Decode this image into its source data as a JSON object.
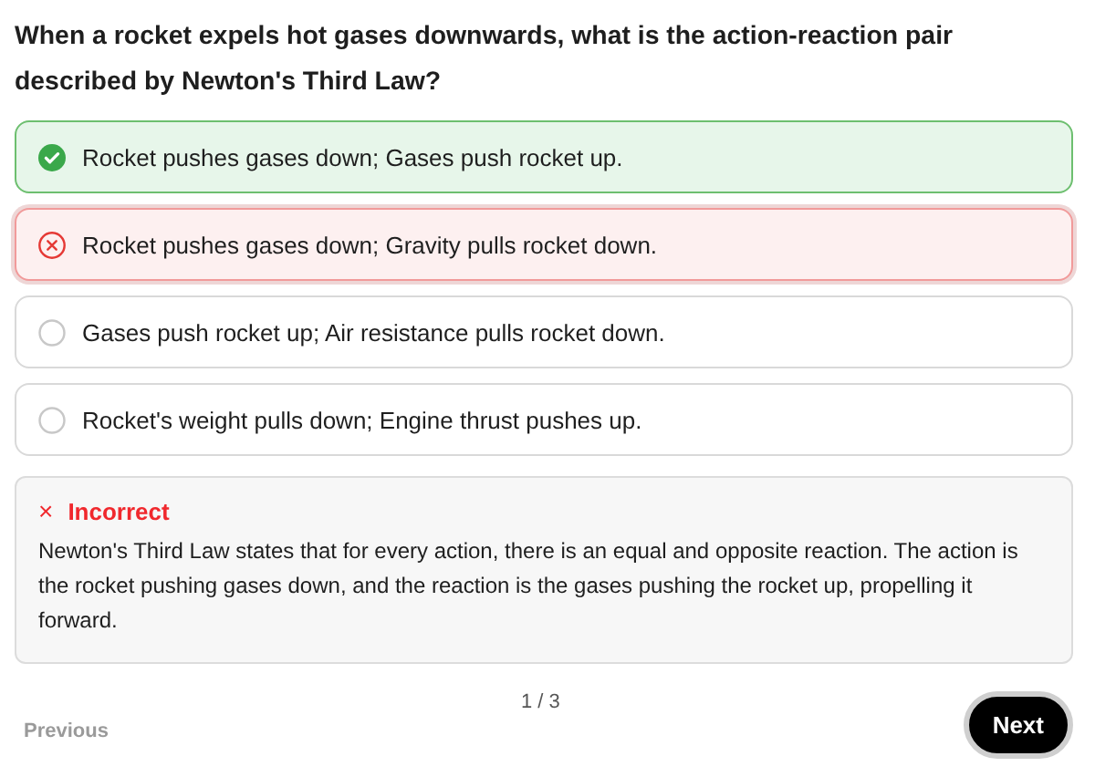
{
  "question": "When a rocket expels hot gases downwards, what is the action-reaction pair described by Newton's Third Law?",
  "options": [
    {
      "label": "Rocket pushes gases down; Gases push rocket up.",
      "kind": "correct",
      "selected": false
    },
    {
      "label": "Rocket pushes gases down; Gravity pulls rocket down.",
      "kind": "wrong",
      "selected": true
    },
    {
      "label": "Gases push rocket up; Air resistance pulls rocket down.",
      "kind": "neutral",
      "selected": false
    },
    {
      "label": "Rocket's weight pulls down; Engine thrust pushes up.",
      "kind": "neutral",
      "selected": false
    }
  ],
  "feedback": {
    "mark": "×",
    "title": "Incorrect",
    "text": "Newton's Third Law states that for every action, there is an equal and opposite reaction. The action is the rocket pushing gases down, and the reaction is the gases pushing the rocket up, propelling it forward."
  },
  "footer": {
    "previous": {
      "label": "Previous",
      "disabled": true
    },
    "progress": "1 / 3",
    "next": {
      "label": "Next",
      "disabled": false
    }
  }
}
